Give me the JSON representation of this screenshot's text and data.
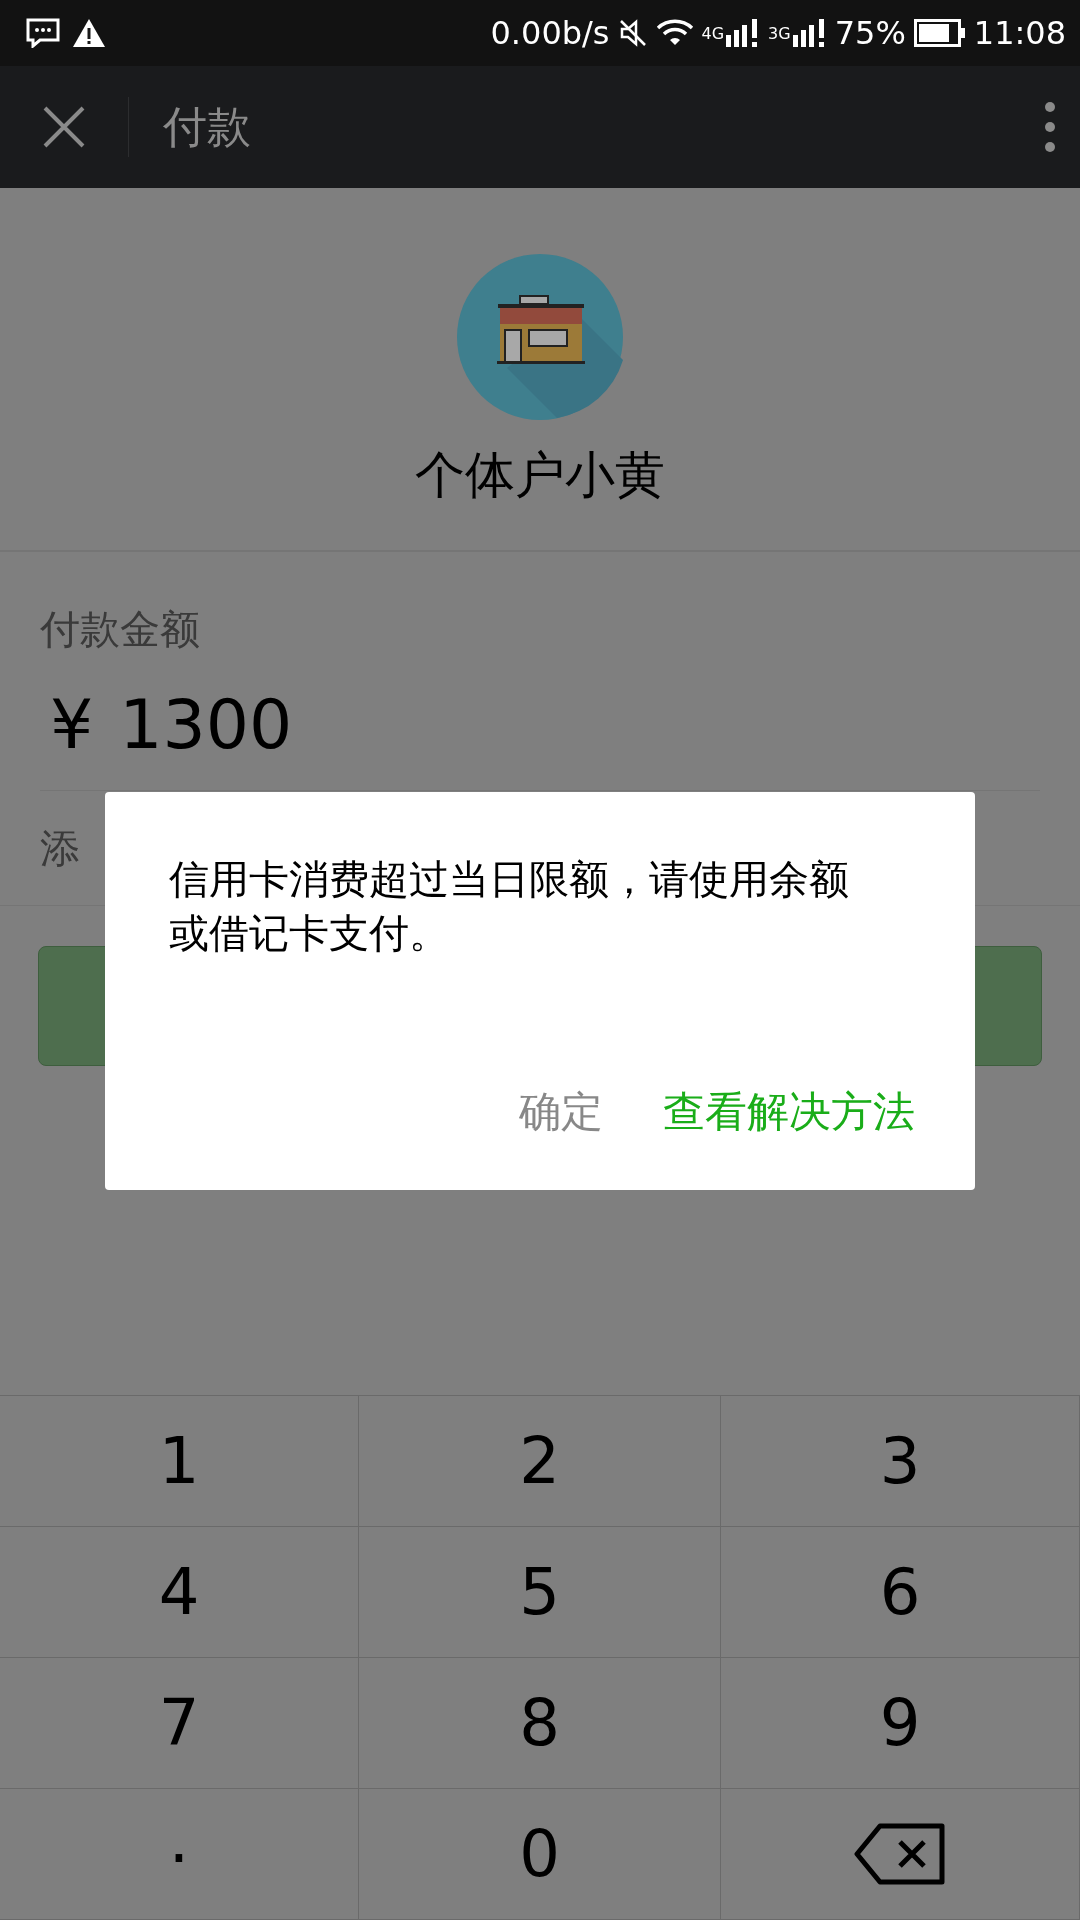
{
  "status_bar": {
    "speed": "0.00b/s",
    "networks": [
      "4G",
      "3G"
    ],
    "battery": "75%",
    "time": "11:08"
  },
  "nav": {
    "title": "付款"
  },
  "merchant": {
    "name": "个体户小黄"
  },
  "payment": {
    "label": "付款金额",
    "currency": "¥",
    "amount": "1300",
    "note": "添"
  },
  "dialog": {
    "message": "信用卡消费超过当日限额，请使用余额或借记卡支付。",
    "buttons": [
      {
        "label": "确定",
        "kind": "secondary"
      },
      {
        "label": "查看解决方法",
        "kind": "primary"
      }
    ]
  },
  "keypad": [
    {
      "label": "1",
      "kind": "key"
    },
    {
      "label": "2",
      "kind": "key"
    },
    {
      "label": "3",
      "kind": "key"
    },
    {
      "label": "4",
      "kind": "key"
    },
    {
      "label": "5",
      "kind": "key"
    },
    {
      "label": "6",
      "kind": "key"
    },
    {
      "label": "7",
      "kind": "key"
    },
    {
      "label": "8",
      "kind": "key"
    },
    {
      "label": "9",
      "kind": "key"
    },
    {
      "label": ".",
      "kind": "point"
    },
    {
      "label": "0",
      "kind": "key"
    },
    {
      "kind": "backspace"
    }
  ]
}
